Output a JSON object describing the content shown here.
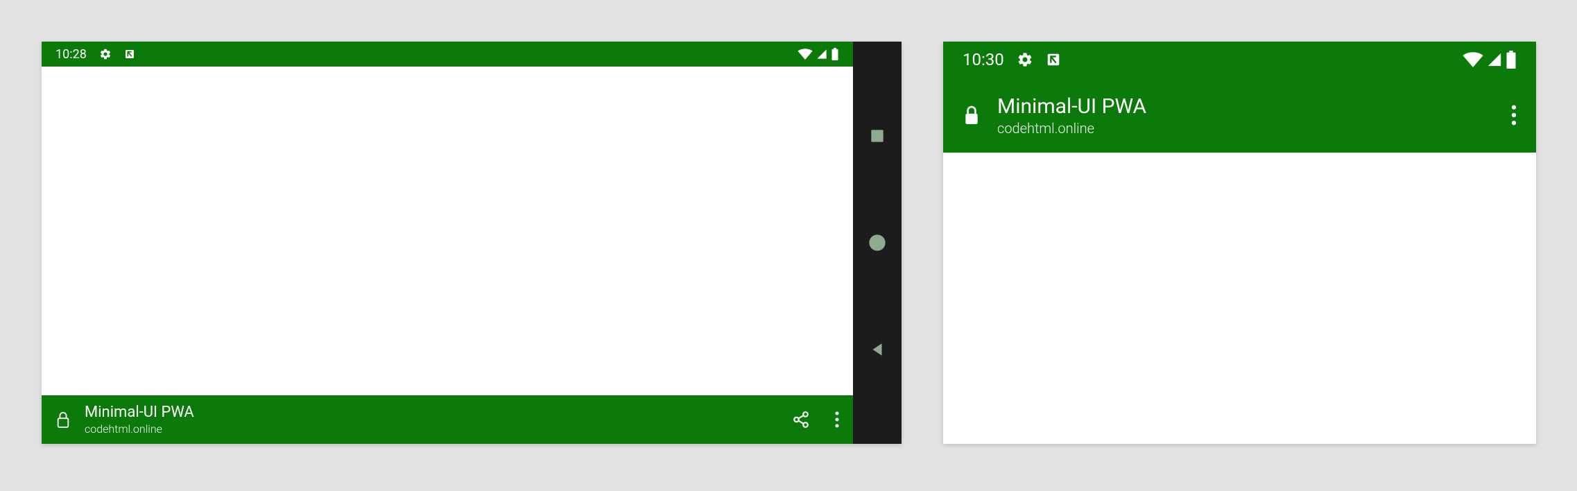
{
  "left": {
    "status": {
      "time": "10:28"
    },
    "app": {
      "title": "Minimal-UI PWA",
      "host": "codehtml.online"
    }
  },
  "right": {
    "status": {
      "time": "10:30"
    },
    "app": {
      "title": "Minimal-UI PWA",
      "host": "codehtml.online"
    }
  },
  "colors": {
    "theme": "#0b7a0b",
    "navbar": "#1c1c1c",
    "navbtn": "#a4c4a4"
  }
}
